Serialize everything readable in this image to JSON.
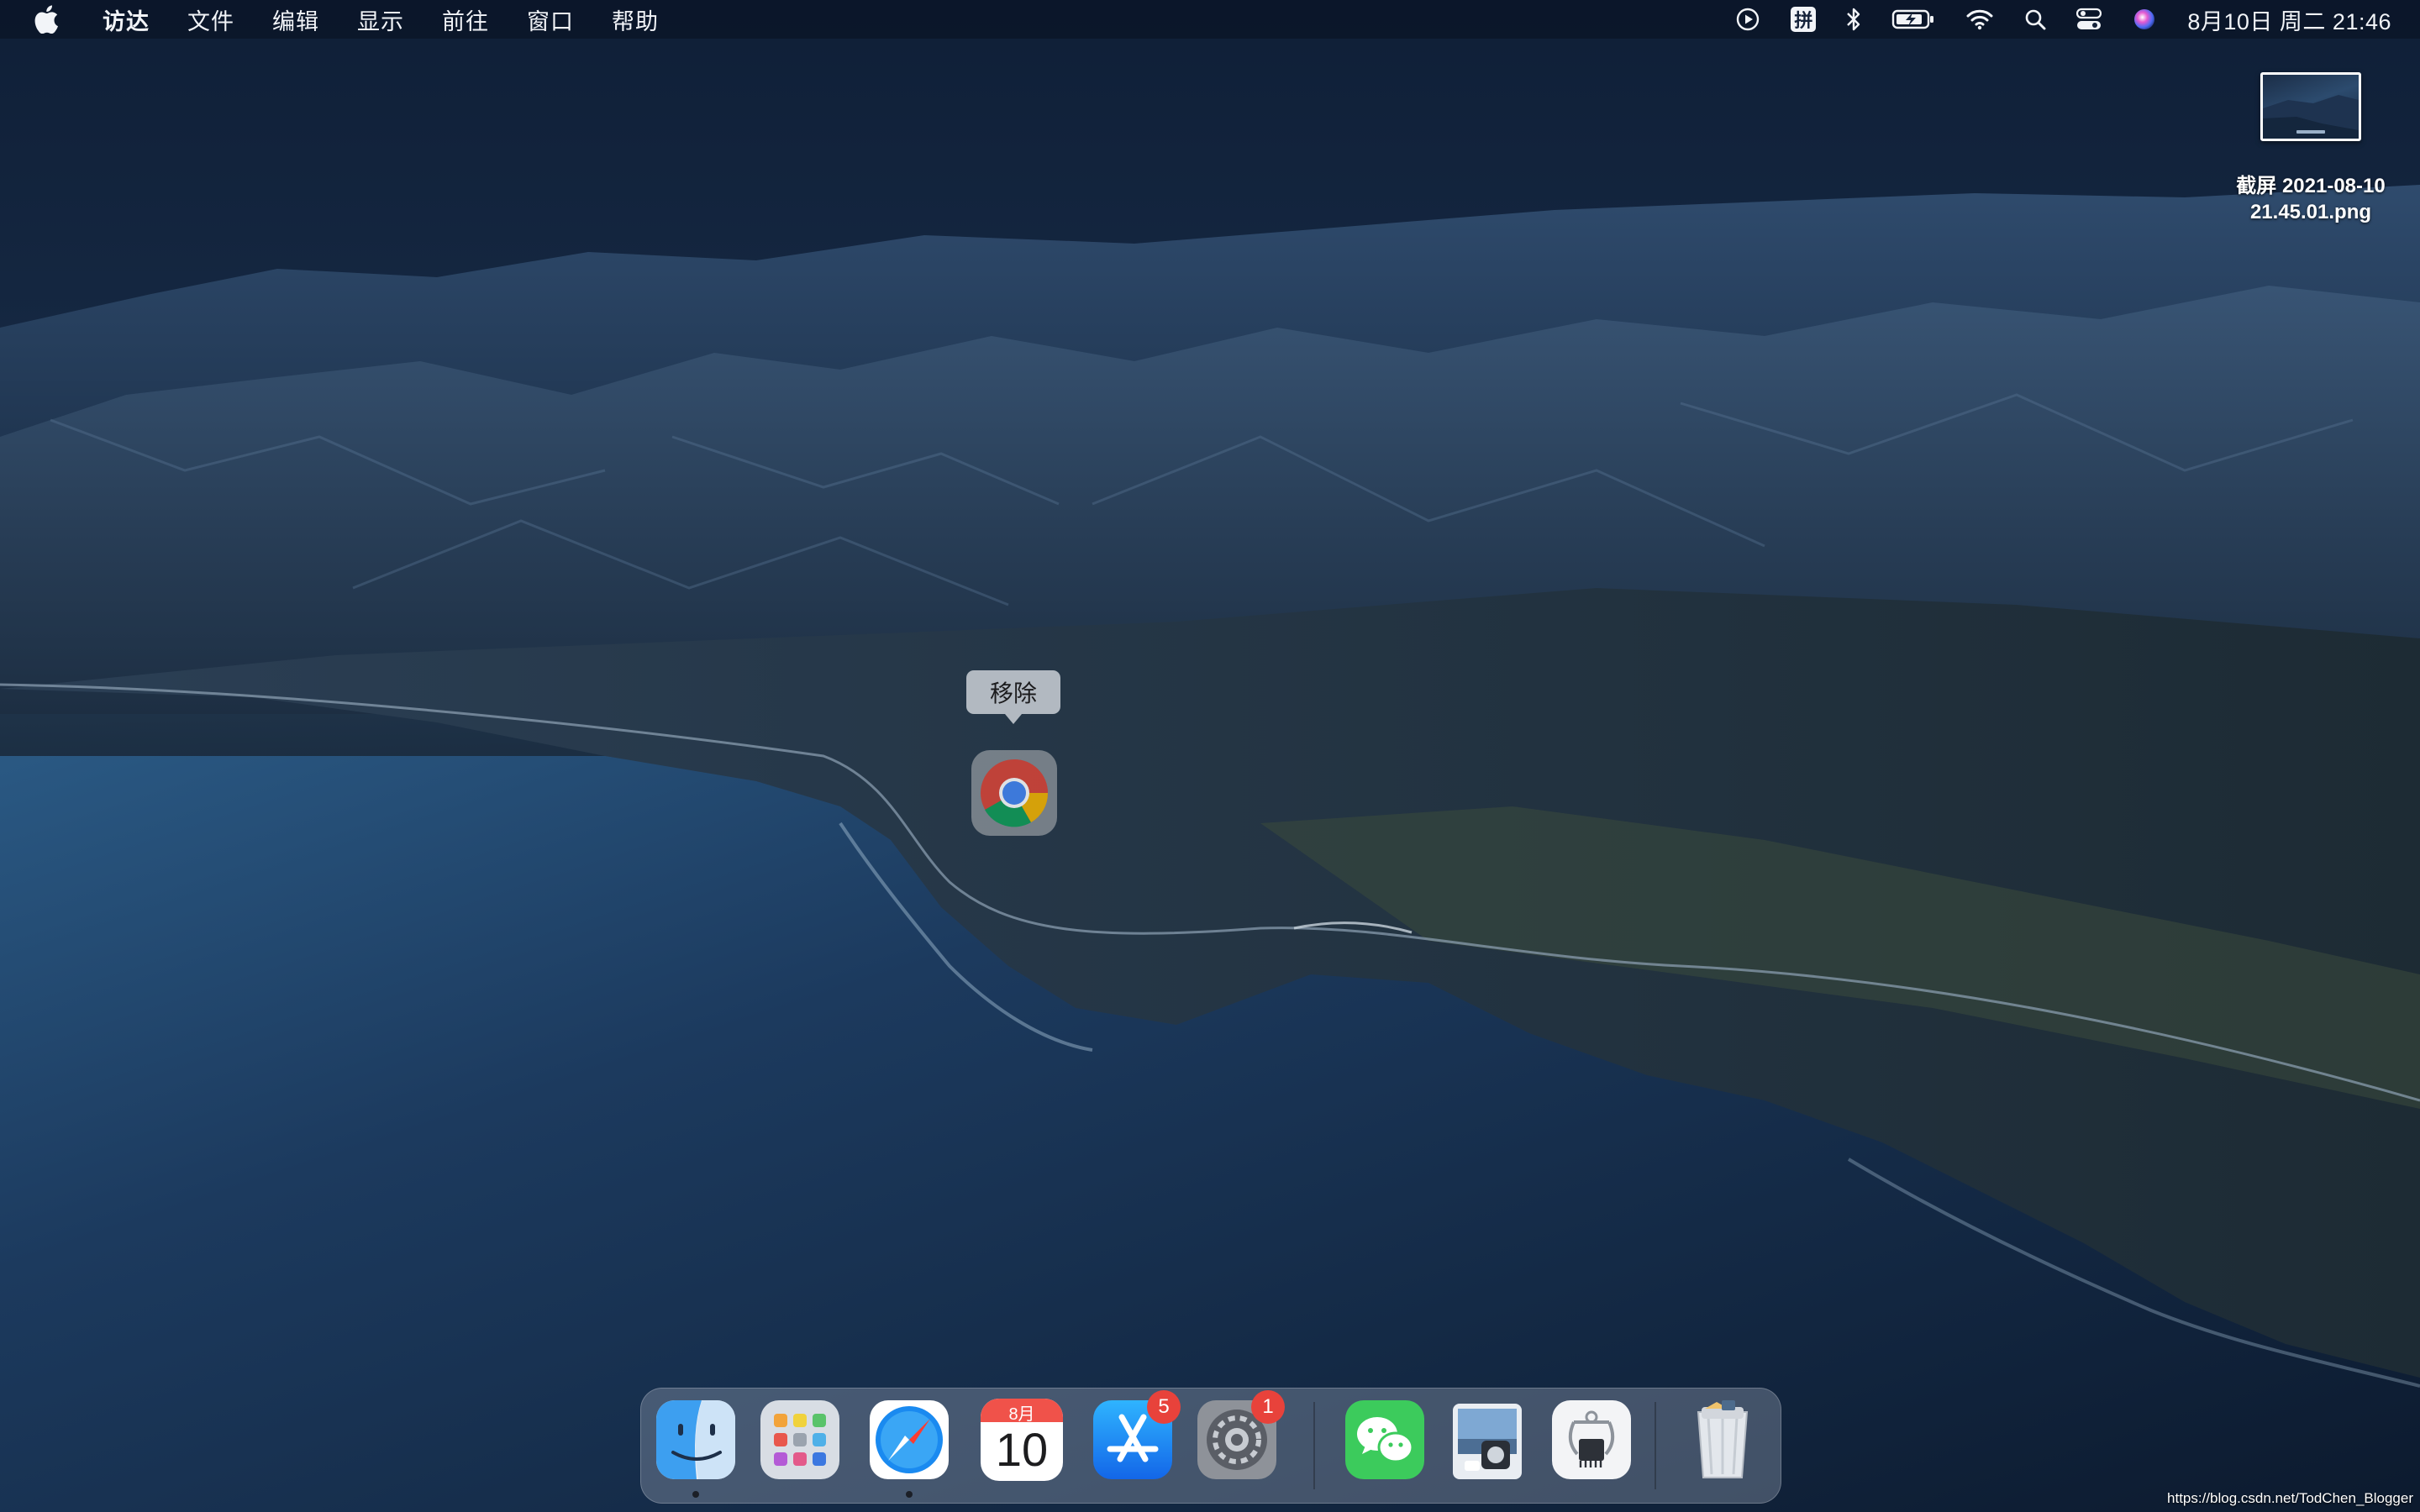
{
  "menubar": {
    "items": [
      "访达",
      "文件",
      "编辑",
      "显示",
      "前往",
      "窗口",
      "帮助"
    ],
    "ime_label": "拼",
    "clock": "8月10日 周二  21:46"
  },
  "desktop": {
    "file": {
      "name_line1": "截屏 2021-08-10",
      "name_line2": "21.45.01.png"
    },
    "drag_tooltip": "移除",
    "dragged_app_icon": "chrome-icon"
  },
  "dock": {
    "apps": [
      {
        "name": "finder-icon",
        "running": true
      },
      {
        "name": "launchpad-icon",
        "running": false
      },
      {
        "name": "safari-icon",
        "running": true
      },
      {
        "name": "calendar-icon",
        "running": false,
        "month": "8月",
        "day": "10"
      },
      {
        "name": "app-store-icon",
        "running": false,
        "badge": "5"
      },
      {
        "name": "system-preferences-icon",
        "running": false,
        "badge": "1"
      },
      {
        "name": "wechat-icon",
        "running": false
      },
      {
        "name": "preview-icon",
        "running": false
      },
      {
        "name": "system-information-icon",
        "running": false
      },
      {
        "name": "trash-icon",
        "running": false
      }
    ]
  },
  "watermark": "https://blog.csdn.net/TodChen_Blogger",
  "colors": {
    "menubar_bg": "#0a1426",
    "badge": "#e8423b",
    "sea": "#1c3a5e",
    "mountains": "#2b4566"
  }
}
